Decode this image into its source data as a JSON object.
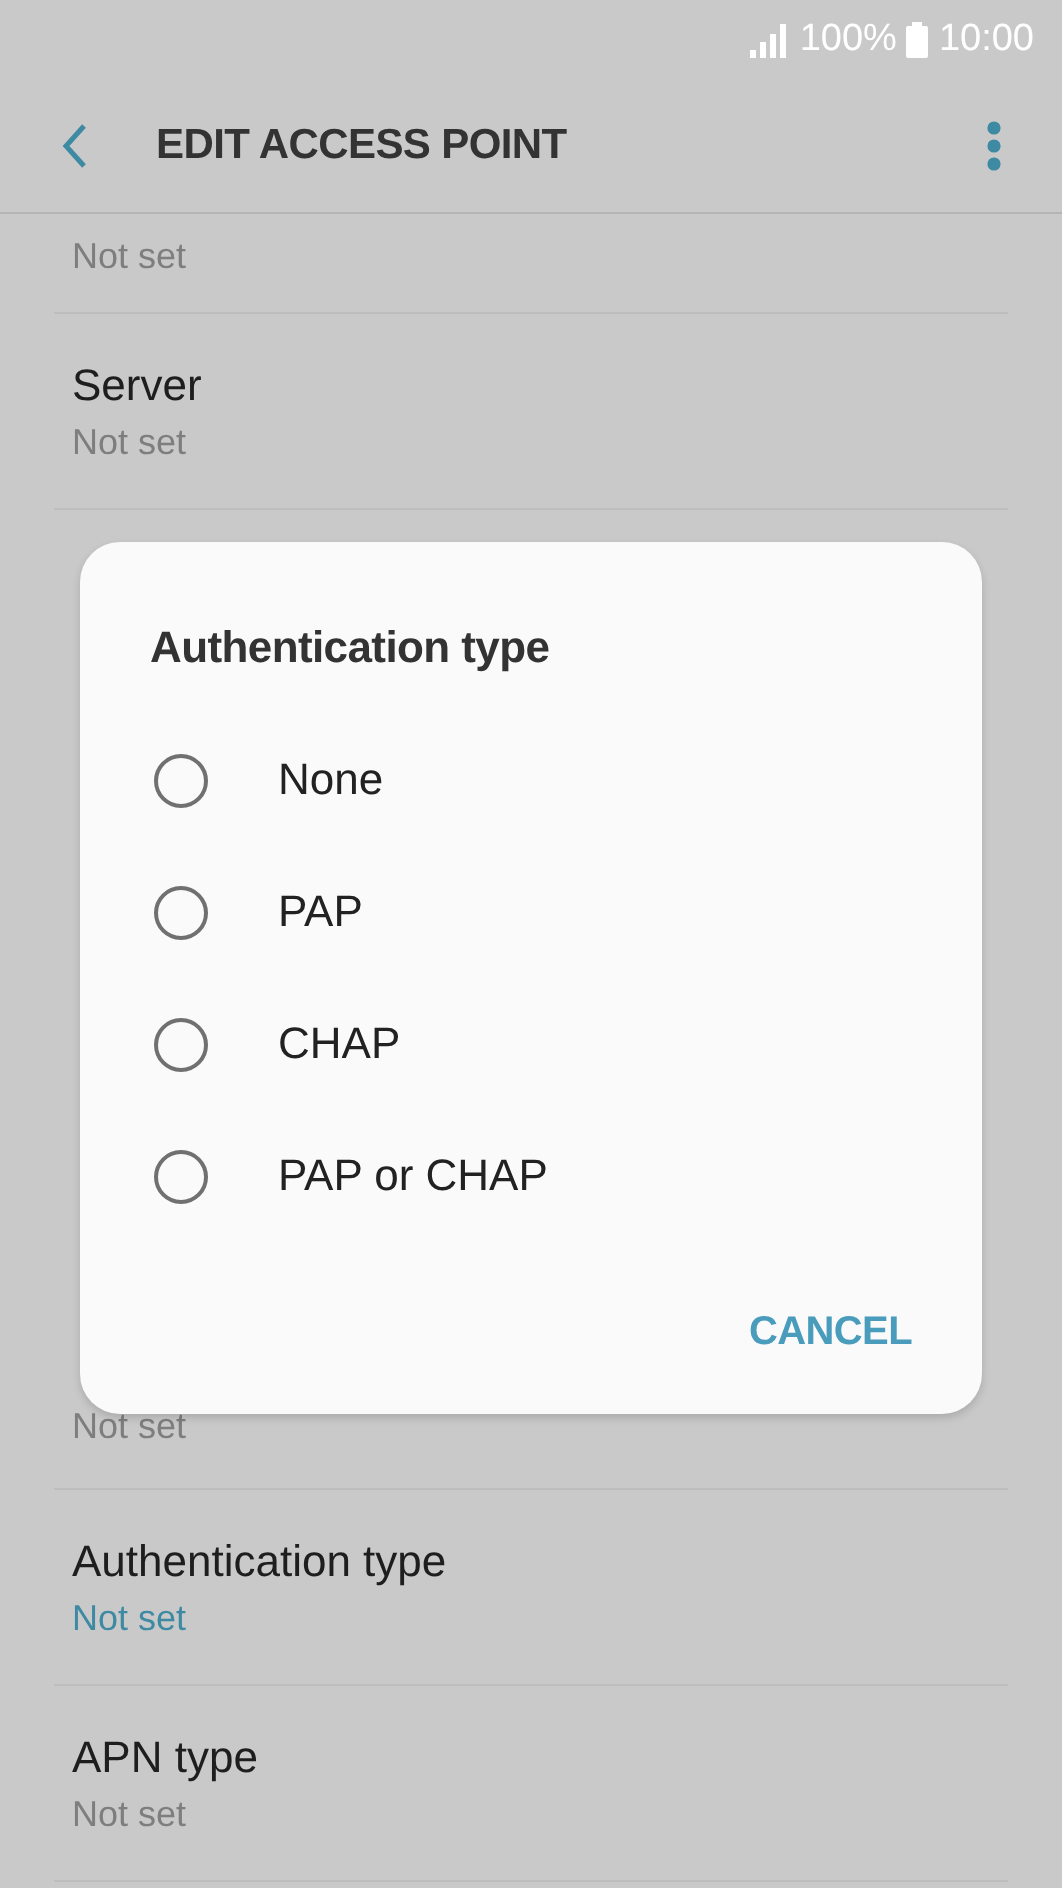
{
  "status_bar": {
    "battery": "100%",
    "time": "10:00"
  },
  "header": {
    "title": "EDIT ACCESS POINT"
  },
  "settings_above": [
    {
      "value": "Not set",
      "accent": false
    },
    {
      "title": "Server",
      "value": "Not set",
      "accent": false
    }
  ],
  "settings_below": [
    {
      "value": "Not set",
      "accent": false
    },
    {
      "title": "Authentication type",
      "value": "Not set",
      "accent": true
    },
    {
      "title": "APN type",
      "value": "Not set",
      "accent": false
    }
  ],
  "dialog": {
    "title": "Authentication type",
    "options": [
      {
        "label": "None",
        "selected": false
      },
      {
        "label": "PAP",
        "selected": false
      },
      {
        "label": "CHAP",
        "selected": false
      },
      {
        "label": "PAP or CHAP",
        "selected": false
      }
    ],
    "buttons": [
      "CANCEL"
    ]
  }
}
